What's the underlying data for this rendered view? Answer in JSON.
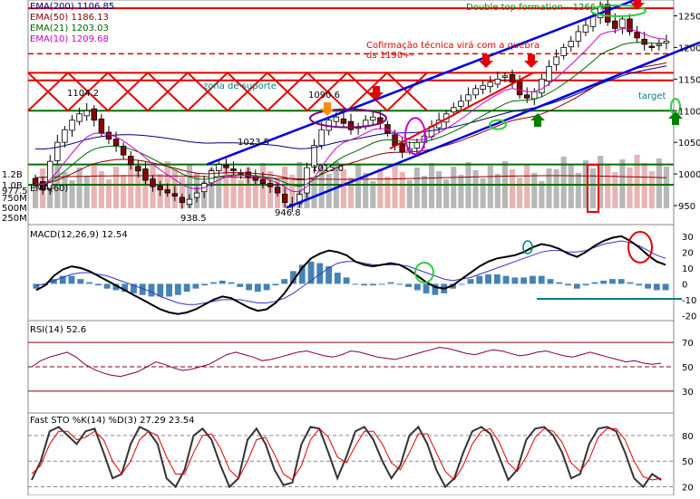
{
  "chart_data": [
    {
      "type": "candlestick",
      "panel": "price",
      "legend": [
        {
          "label": "EMA(200) 1106.85",
          "color": "#000080"
        },
        {
          "label": "EMA(50) 1186.13",
          "color": "#8b0000"
        },
        {
          "label": "EMA(21) 1203.03",
          "color": "#006400"
        },
        {
          "label": "EMA(10) 1209.68",
          "color": "#cc00cc"
        }
      ],
      "ylim": [
        920,
        1275
      ],
      "yticks": [
        950,
        1000,
        1050,
        1100,
        1150,
        1200,
        1250
      ],
      "annotations": {
        "double_top": "Double top formation---1266.7",
        "confirmation_line1": "Cofirmação técnica virá com a quebra",
        "confirmation_line2": "ds 1190+-",
        "support_zone": "zona de suporte",
        "target": "target",
        "price_labels": [
          {
            "text": "1104.2",
            "value": 1104.2
          },
          {
            "text": "1090.6",
            "value": 1090.6
          },
          {
            "text": "1023.5",
            "value": 1023.5
          },
          {
            "text": "1015.0",
            "value": 1015.0
          },
          {
            "text": "938.5",
            "value": 938.5
          },
          {
            "text": "946.8",
            "value": 946.8
          }
        ]
      },
      "horizontal_levels": [
        {
          "value": 1262,
          "color": "#e00000"
        },
        {
          "value": 1160,
          "color": "#e00000"
        },
        {
          "value": 1148,
          "color": "#e00000"
        },
        {
          "value": 1100,
          "color": "#007000"
        },
        {
          "value": 1015,
          "color": "#007000"
        },
        {
          "value": 983,
          "color": "#007000"
        },
        {
          "value": 1190,
          "color": "#e00000",
          "dashed": true
        }
      ],
      "closes": [
        985,
        975,
        1020,
        1050,
        1070,
        1085,
        1095,
        1100,
        1085,
        1065,
        1055,
        1045,
        1030,
        1015,
        1005,
        990,
        980,
        975,
        970,
        965,
        955,
        960,
        970,
        985,
        1005,
        1015,
        1010,
        1005,
        1000,
        995,
        990,
        985,
        980,
        970,
        955,
        950,
        968,
        1010,
        1045,
        1070,
        1085,
        1090,
        1080,
        1070,
        1075,
        1085,
        1090,
        1080,
        1065,
        1045,
        1035,
        1040,
        1050,
        1060,
        1075,
        1085,
        1095,
        1105,
        1115,
        1125,
        1135,
        1140,
        1145,
        1150,
        1155,
        1145,
        1125,
        1120,
        1130,
        1150,
        1170,
        1185,
        1200,
        1210,
        1225,
        1235,
        1250,
        1265,
        1240,
        1230,
        1245,
        1225,
        1215,
        1205,
        1200,
        1205,
        1210
      ]
    },
    {
      "type": "bar",
      "panel": "volume",
      "legend": "EMA(60)",
      "yticks": [
        "1.2B",
        "1.0B",
        "977.5",
        "750M",
        "500M",
        "250M"
      ]
    },
    {
      "type": "line",
      "panel": "macd",
      "legend": "MACD(12,26,9)  12.54",
      "ylim": [
        -22,
        35
      ],
      "yticks": [
        30,
        20,
        10,
        0,
        -10,
        -20
      ],
      "macd": [
        -4,
        -1,
        5,
        9,
        11,
        10,
        8,
        5,
        2,
        -1,
        -4,
        -7,
        -10,
        -13,
        -16,
        -18,
        -19,
        -18,
        -16,
        -13,
        -10,
        -8,
        -9,
        -12,
        -15,
        -17,
        -16,
        -12,
        -6,
        2,
        10,
        16,
        19,
        21,
        20,
        18,
        14,
        12,
        11,
        12,
        13,
        12,
        9,
        5,
        1,
        -2,
        -3,
        -1,
        3,
        7,
        11,
        14,
        16,
        17,
        18,
        20,
        23,
        25,
        24,
        22,
        19,
        17,
        20,
        24,
        27,
        29,
        30,
        27,
        23,
        18,
        14,
        12
      ],
      "signal": [
        -1,
        0,
        2,
        4,
        6,
        7,
        7,
        6,
        5,
        3,
        1,
        -1,
        -3,
        -5,
        -8,
        -10,
        -12,
        -13,
        -13,
        -12,
        -11,
        -10,
        -10,
        -10,
        -11,
        -12,
        -12,
        -11,
        -9,
        -6,
        -2,
        2,
        6,
        10,
        13,
        14,
        14,
        13,
        12,
        12,
        12,
        12,
        11,
        9,
        7,
        5,
        3,
        2,
        3,
        4,
        6,
        8,
        10,
        12,
        14,
        16,
        18,
        20,
        21,
        21,
        20,
        20,
        21,
        23,
        25,
        26,
        27,
        26,
        24,
        21,
        18,
        16
      ]
    },
    {
      "type": "line",
      "panel": "rsi",
      "legend": "RSI(14)  52.6",
      "ylim": [
        15,
        85
      ],
      "yticks": [
        70,
        50,
        30
      ],
      "values": [
        50,
        55,
        58,
        60,
        62,
        58,
        52,
        48,
        45,
        43,
        42,
        44,
        46,
        50,
        54,
        52,
        49,
        47,
        48,
        50,
        52,
        56,
        60,
        62,
        60,
        58,
        55,
        56,
        58,
        60,
        62,
        63,
        61,
        59,
        58,
        60,
        63,
        62,
        60,
        58,
        57,
        56,
        58,
        60,
        62,
        64,
        66,
        65,
        63,
        61,
        60,
        62,
        64,
        63,
        61,
        59,
        60,
        62,
        63,
        61,
        59,
        58,
        60,
        62,
        60,
        58,
        56,
        54,
        55,
        53,
        52,
        53
      ]
    },
    {
      "type": "line",
      "panel": "stochastic",
      "legend": "Fast STO %K(14) %D(3)  27.29  23.54",
      "ylim": [
        10,
        100
      ],
      "yticks": [
        80,
        50,
        20
      ],
      "k": [
        28,
        50,
        85,
        90,
        80,
        70,
        85,
        88,
        60,
        30,
        35,
        70,
        90,
        85,
        70,
        30,
        20,
        40,
        80,
        88,
        75,
        45,
        20,
        30,
        75,
        88,
        70,
        40,
        22,
        25,
        70,
        90,
        88,
        60,
        30,
        55,
        85,
        90,
        75,
        50,
        30,
        45,
        80,
        90,
        70,
        40,
        20,
        30,
        60,
        85,
        90,
        82,
        55,
        28,
        40,
        75,
        88,
        90,
        80,
        60,
        30,
        35,
        70,
        88,
        90,
        85,
        60,
        30,
        20,
        35,
        28
      ],
      "d": [
        35,
        45,
        70,
        85,
        85,
        75,
        78,
        85,
        75,
        50,
        35,
        50,
        75,
        85,
        80,
        55,
        35,
        35,
        60,
        80,
        82,
        65,
        40,
        30,
        50,
        75,
        78,
        58,
        35,
        28,
        45,
        75,
        88,
        78,
        55,
        48,
        68,
        85,
        85,
        70,
        48,
        40,
        60,
        82,
        82,
        60,
        38,
        28,
        45,
        70,
        85,
        88,
        72,
        48,
        38,
        55,
        78,
        88,
        85,
        72,
        48,
        38,
        52,
        78,
        88,
        88,
        75,
        50,
        32,
        28,
        30
      ]
    }
  ]
}
